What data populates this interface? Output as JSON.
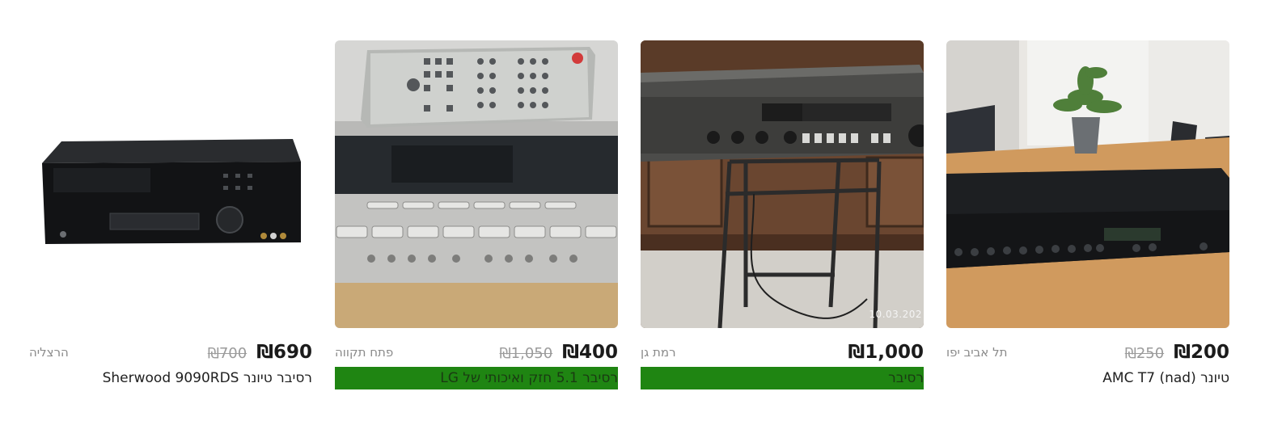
{
  "listings": [
    {
      "image_desc": "black stereo tuner on a wooden table",
      "date_stamp": "",
      "price": "₪200",
      "old_price": "₪250",
      "location": "תל אביב יפו",
      "title": "טיונר (nad) AMC T7",
      "highlight": false
    },
    {
      "image_desc": "silver stereo receiver on a metal stand",
      "date_stamp": "10.03.202",
      "price": "₪1,000",
      "old_price": "",
      "location": "רמת גן",
      "title": "רסיבר",
      "highlight": true
    },
    {
      "image_desc": "LG 5.1 receiver with remote control",
      "date_stamp": "",
      "price": "₪400",
      "old_price": "₪1,050",
      "location": "פתח תקווה",
      "title": "רסיבר 5.1 חזק ואיכותי של LG",
      "highlight": true
    },
    {
      "image_desc": "black Sherwood receiver",
      "date_stamp": "",
      "price": "₪690",
      "old_price": "₪700",
      "location": "הרצליה",
      "title": "רסיבר טיונר Sherwood 9090RDS",
      "highlight": false
    }
  ],
  "colors": {
    "highlight_bg": "#1f8512",
    "price": "#1b1b1b",
    "old_price": "#9b9b9b",
    "location": "#8a8a8a"
  }
}
